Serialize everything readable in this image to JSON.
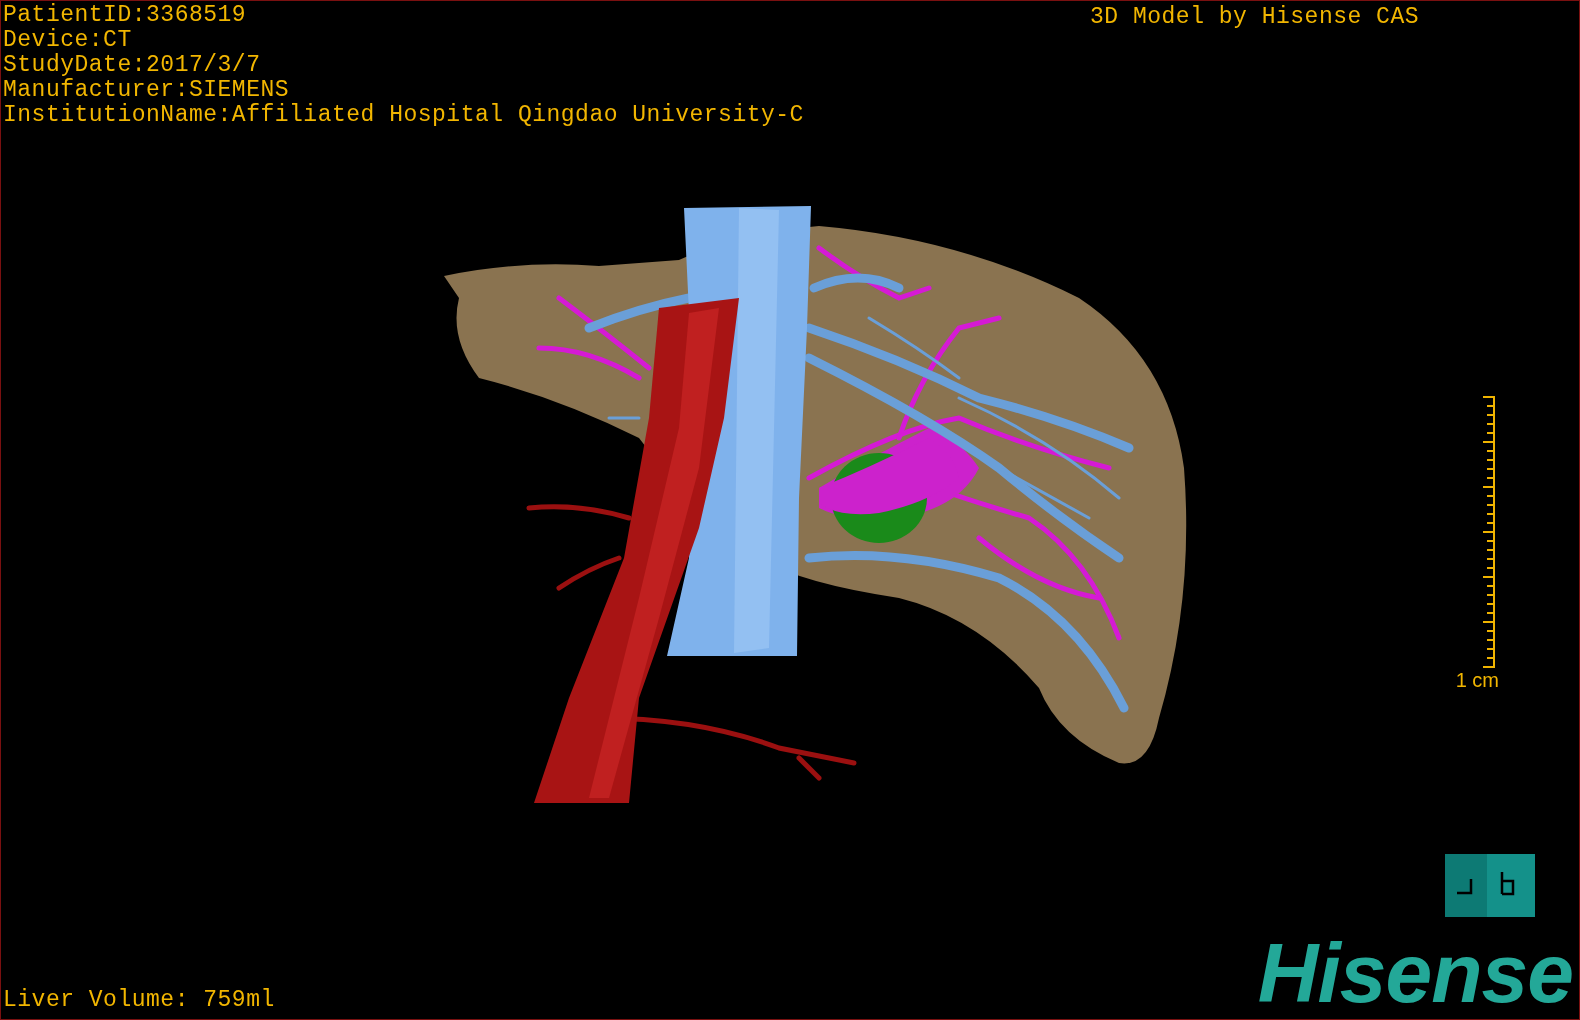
{
  "study_info": [
    "PatientID:3368519",
    "Device:CT",
    "StudyDate:2017/3/7",
    "Manufacturer:SIEMENS",
    "InstitutionName:Affiliated Hospital Qingdao University-C"
  ],
  "title": "3D Model by Hisense CAS",
  "scale_bar": {
    "label": "1 cm"
  },
  "liver_volume": "Liver Volume: 759ml",
  "logo": "Hisense"
}
